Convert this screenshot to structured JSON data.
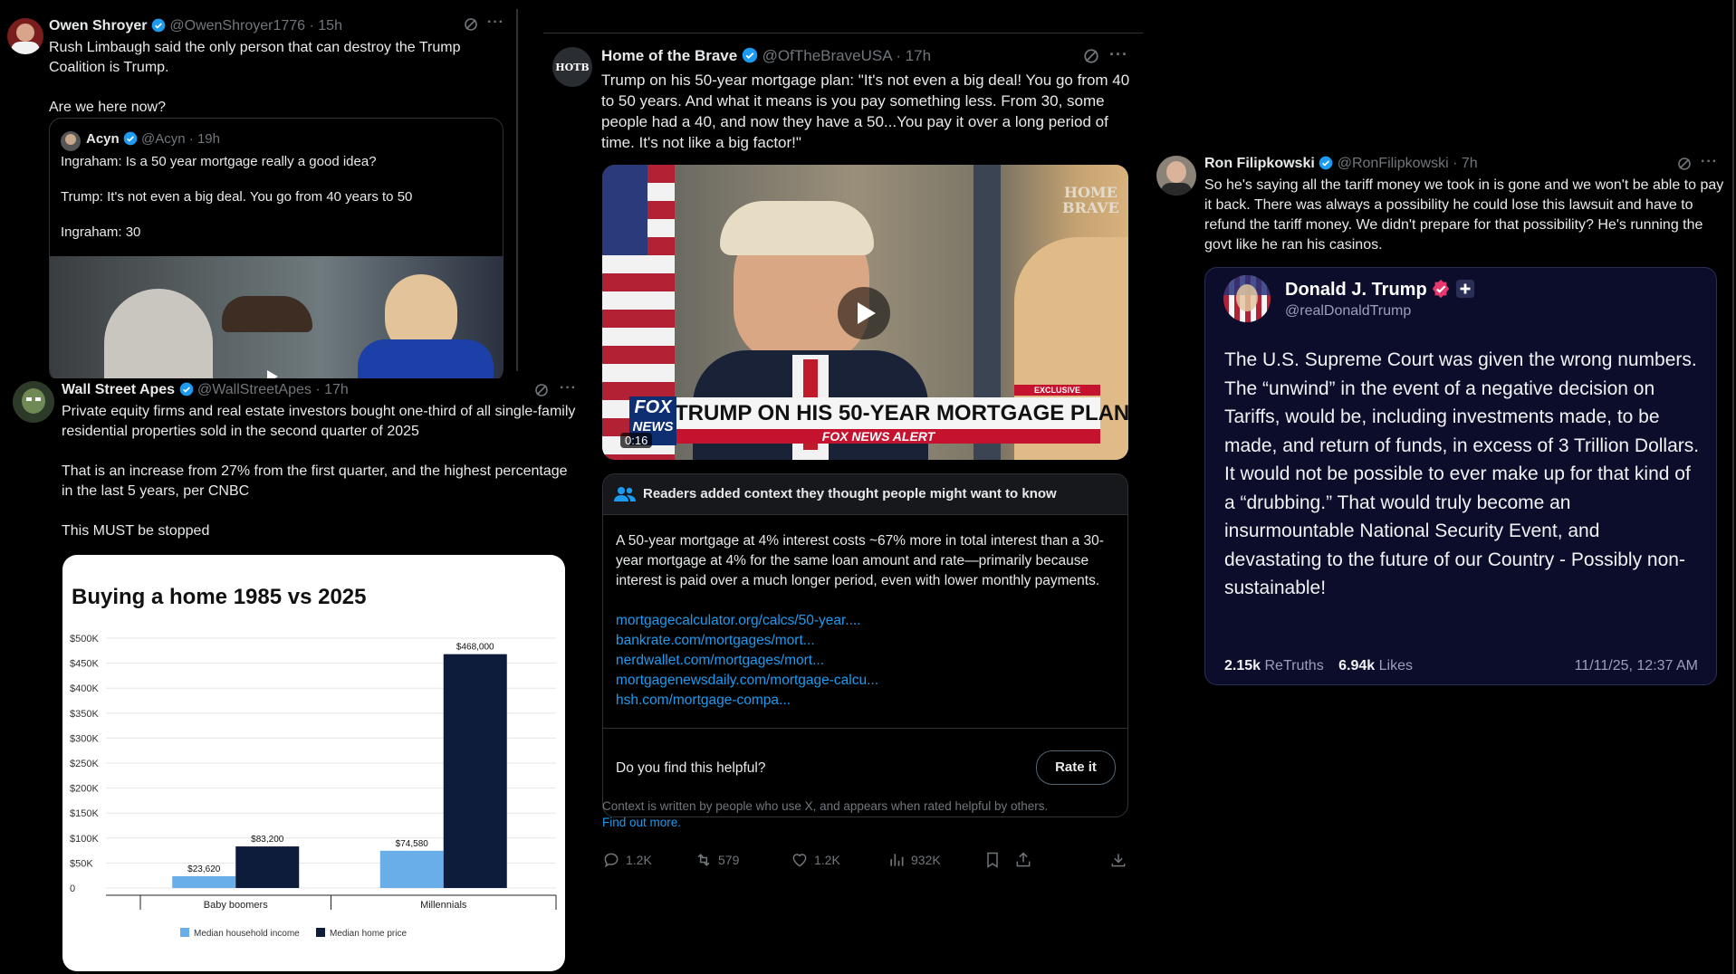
{
  "post1": {
    "name": "Owen Shroyer",
    "handle": "@OwenShroyer1776",
    "time": "· 15h",
    "lines": [
      "Rush Limbaugh said the only person that can destroy the Trump Coalition is Trump.",
      "Are we here now?"
    ],
    "quote": {
      "name": "Acyn",
      "handle": "@Acyn",
      "time": "· 19h",
      "lines": [
        "Ingraham: Is a 50 year mortgage really a good idea?",
        "Trump: It's not even a big deal. You go from 40 years to 50",
        "Ingraham: 30"
      ]
    }
  },
  "post2": {
    "name": "Wall Street Apes",
    "handle": "@WallStreetApes",
    "time": "· 17h",
    "lines": [
      "Private equity firms and real estate investors bought one-third of all single-family residential properties sold in the second quarter of 2025",
      "That is an increase from 27% from the first quarter, and the highest percentage in the last 5 years, per CNBC",
      "This MUST be stopped"
    ]
  },
  "chart_data": {
    "type": "bar",
    "title": "Buying a home 1985 vs 2025",
    "categories": [
      "Baby boomers",
      "Millennials"
    ],
    "series": [
      {
        "name": "Median household income",
        "values": [
          23620,
          74580
        ],
        "labels": [
          "$23,620",
          "$74,580"
        ],
        "color": "#6aaee9"
      },
      {
        "name": "Median home price",
        "values": [
          83200,
          468000
        ],
        "labels": [
          "$83,200",
          "$468,000"
        ],
        "color": "#0e1c3b"
      }
    ],
    "yticks": [
      "0",
      "$50K",
      "$100K",
      "$150K",
      "$200K",
      "$250K",
      "$300K",
      "$350K",
      "$400K",
      "$450K",
      "$500K"
    ],
    "ylim": [
      0,
      500000
    ],
    "legend": "bottom"
  },
  "post3": {
    "avatar_text": "HOTB",
    "name": "Home of the Brave",
    "handle": "@OfTheBraveUSA",
    "time": "· 17h",
    "lines": [
      "Trump on his 50-year mortgage plan: \"It's not even a big deal! You go from 40 to 50 years. And what it means is you pay something less. From 30, some people had a 40, and now they have a 50...You pay it over a long period of time. It's not like a big factor!\""
    ],
    "video": {
      "watermark_top": "HOME",
      "watermark_bottom": "BRAVE",
      "badge": "EXCLUSIVE",
      "chyron": "TRUMP ON HIS 50-YEAR MORTGAGE PLAN",
      "alert": "FOX NEWS ALERT",
      "logo_top": "FOX",
      "logo_bottom": "NEWS",
      "duration": "0:16"
    },
    "note": {
      "header": "Readers added context they thought people might want to know",
      "text": "A 50-year mortgage at 4% interest costs ~67% more in total interest than a 30-year mortgage at 4% for the same loan amount and rate—primarily because interest is paid over a much longer period, even with lower monthly payments.",
      "links": [
        "mortgagecalculator.org/calcs/50-year....",
        "bankrate.com/mortgages/mort...",
        "nerdwallet.com/mortgages/mort...",
        "mortgagenewsdaily.com/mortgage-calcu...",
        "hsh.com/mortgage-compa..."
      ],
      "question": "Do you find this helpful?",
      "rate_label": "Rate it"
    },
    "footnote": "Context is written by people who use X, and appears when rated helpful by others.",
    "find_out": "Find out more.",
    "actions": {
      "replies": "1.2K",
      "reposts": "579",
      "likes": "1.2K",
      "views": "932K"
    }
  },
  "post4": {
    "name": "Ron Filipkowski",
    "handle": "@RonFilipkowski",
    "time": "· 7h",
    "lines": [
      "So he's saying all the tariff money we took in is gone and we won't be able to pay it back. There was always a possibility he could lose this lawsuit and have to refund the tariff money. We didn't prepare for that possibility? He's running the govt like he ran his casinos."
    ],
    "truth": {
      "name": "Donald J. Trump",
      "handle": "@realDonaldTrump",
      "text": "The U.S. Supreme Court was given the wrong numbers. The “unwind” in the event of a negative decision on Tariffs, would be, including investments made, to be made, and return of funds, in excess of 3 Trillion Dollars. It would not be possible to ever make up for that kind of a “drubbing.” That would truly become an insurmountable National Security Event, and devastating to the future of our Country - Possibly non-sustainable!",
      "retruths_value": "2.15k",
      "retruths_label": "ReTruths",
      "likes_value": "6.94k",
      "likes_label": "Likes",
      "date": "11/11/25, 12:37 AM"
    }
  },
  "colors": {
    "verified": "#1d9bf0",
    "link": "#1d9bf0",
    "truth_bg": "#0b0d2b",
    "truth_badge": "#e8386d"
  }
}
